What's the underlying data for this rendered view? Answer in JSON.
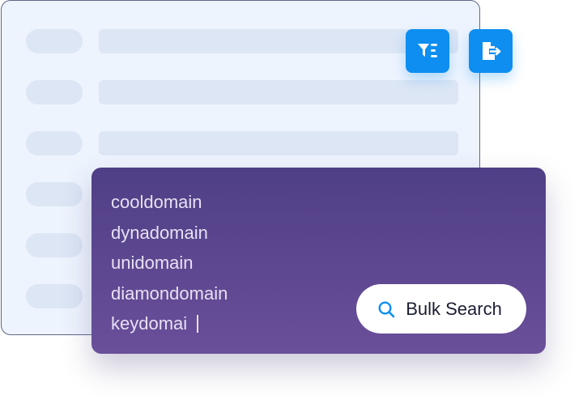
{
  "toolbar": {
    "filter_icon": "filter-list-icon",
    "export_icon": "file-export-icon",
    "accent_color": "#0d8ef0"
  },
  "bulk_search": {
    "domains": [
      "cooldomain",
      "dynadomain",
      "unidomain",
      "diamondomain",
      "keydomai"
    ],
    "button_label": "Bulk Search",
    "button_icon": "search-icon",
    "panel_color": "#5b4690"
  }
}
